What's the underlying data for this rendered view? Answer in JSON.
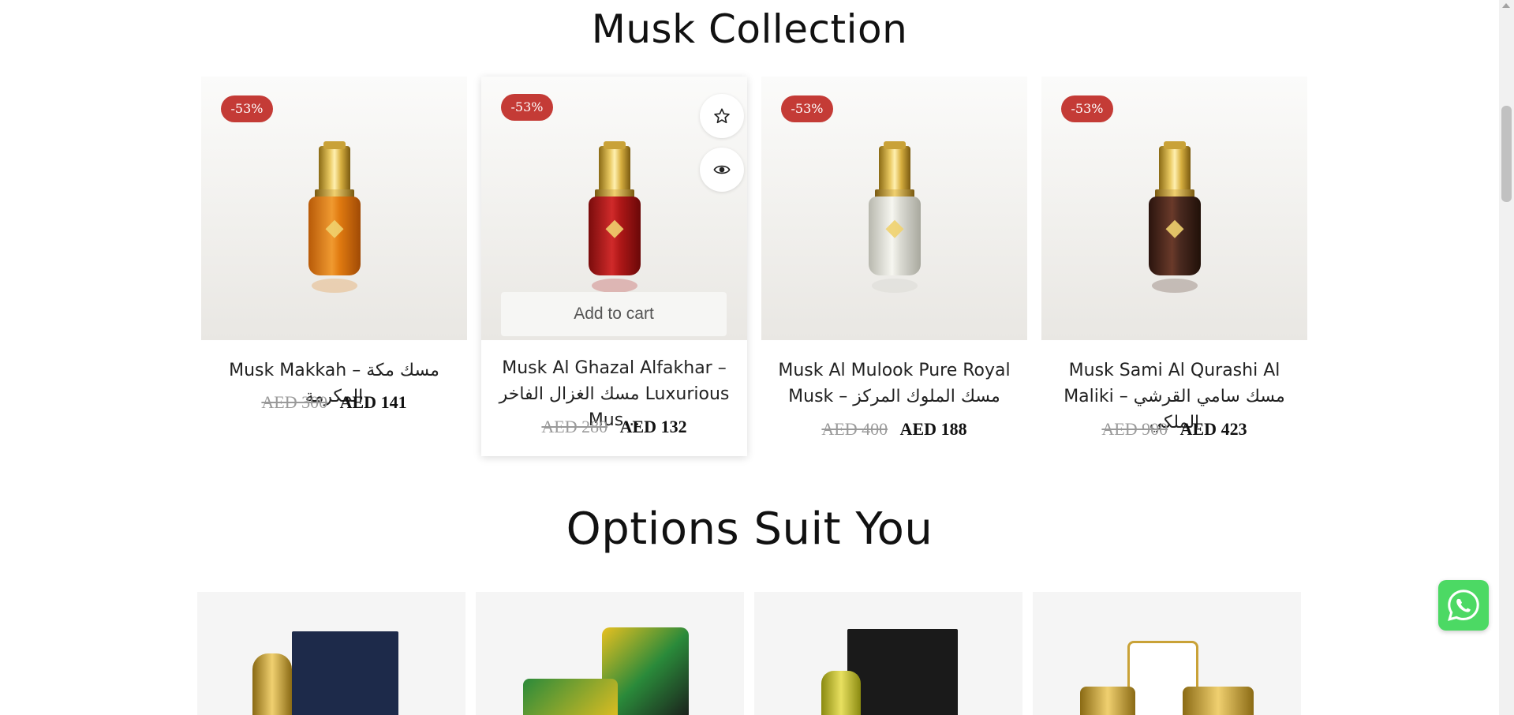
{
  "sections": {
    "musk_title": "Musk Collection",
    "options_title": "Options Suit You"
  },
  "products": [
    {
      "badge": "-53%",
      "name": "Musk Makkah – مسك مكة المكرمة",
      "old_price": "AED 300",
      "new_price": "AED 141",
      "liquid_color": "#e07a10"
    },
    {
      "badge": "-53%",
      "name": "Musk Al Ghazal Alfakhar – مسك الغزال الفاخر Luxurious Mus...",
      "old_price": "AED 280",
      "new_price": "AED 132",
      "liquid_color": "#b01818",
      "add_to_cart_label": "Add to cart",
      "wishlist_icon": "star-icon",
      "quickview_icon": "eye-icon"
    },
    {
      "badge": "-53%",
      "name": "Musk Al Mulook Pure Royal Musk – مسك الملوك المركز",
      "old_price": "AED 400",
      "new_price": "AED 188",
      "liquid_color": "#dcdcd4"
    },
    {
      "badge": "-53%",
      "name": "Musk Sami Al Qurashi Al Maliki – مسك سامي القرشي الملكي",
      "old_price": "AED 900",
      "new_price": "AED 423",
      "liquid_color": "#4a2a20"
    }
  ],
  "floating": {
    "whatsapp_icon": "whatsapp-icon"
  },
  "colors": {
    "badge": "#c43b36",
    "whatsapp": "#4cd964"
  }
}
